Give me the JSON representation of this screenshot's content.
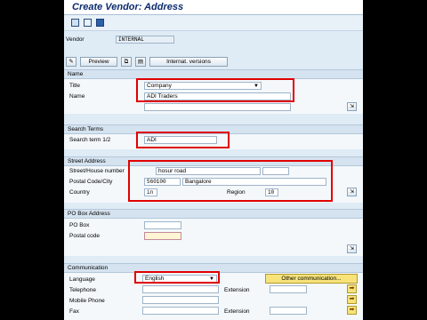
{
  "title": "Create Vendor: Address",
  "vendor": {
    "label": "Vendor",
    "value": "INTERNAL"
  },
  "toolbar": {
    "preview_label": "Preview",
    "internat_label": "Internat. versions"
  },
  "name_section": {
    "heading": "Name",
    "title_label": "Title",
    "title_value": "Company",
    "name_label": "Name",
    "name_value": "ADI Traders"
  },
  "search_terms": {
    "heading": "Search Terms",
    "label": "Search term 1/2",
    "value": "ADI"
  },
  "street_address": {
    "heading": "Street Address",
    "street_label": "Street/House number",
    "street_value": "hosur road",
    "postal_label": "Postal Code/City",
    "postal_value": "560100",
    "city_value": "Bangalore",
    "country_label": "Country",
    "country_value": "in",
    "region_label": "Region",
    "region_value": "10"
  },
  "po_box": {
    "heading": "PO Box Address",
    "po_box_label": "PO Box",
    "postal_label": "Postal code"
  },
  "communication": {
    "heading": "Communication",
    "language_label": "Language",
    "language_value": "English",
    "other_button": "Other communication...",
    "telephone_label": "Telephone",
    "extension_label": "Extension",
    "mobile_label": "Mobile Phone",
    "fax_label": "Fax",
    "fax_extension_label": "Extension"
  },
  "colors": {
    "highlight": "#e00000",
    "title_text": "#0b2b6e"
  }
}
